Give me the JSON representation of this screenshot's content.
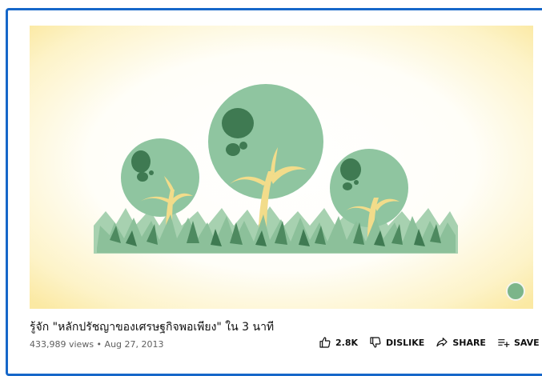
{
  "video": {
    "title": "รู้จัก \"หลักปรัชญาของเศรษฐกิจพอเพียง\" ใน 3 นาที",
    "views": "433,989 views",
    "separator": "•",
    "date": "Aug 27, 2013"
  },
  "actions": {
    "like_count": "2.8K",
    "dislike_label": "DISLIKE",
    "share_label": "SHARE",
    "save_label": "SAVE",
    "more_label": "..."
  },
  "icons": {
    "like": "thumb-up-icon",
    "dislike": "thumb-down-icon",
    "share": "share-arrow-icon",
    "save": "playlist-add-icon",
    "more": "more-horizontal-icon",
    "channel": "channel-logo-icon"
  },
  "colors": {
    "frame_border": "#1667c9",
    "thumbnail_glow": "#fdf0b8",
    "tree_crown": "#8fc5a0",
    "tree_spots": "#3f7a52",
    "trunk": "#f2dc8a",
    "grass": "#8cc09a",
    "grass_dark": "#4e8a60"
  }
}
